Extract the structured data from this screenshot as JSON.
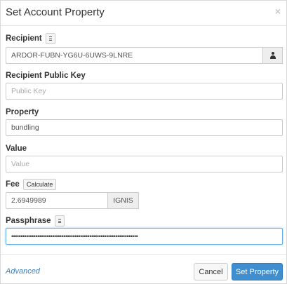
{
  "dialog": {
    "title": "Set Account Property",
    "close_symbol": "×"
  },
  "recipient": {
    "label": "Recipient",
    "value": "ARDOR-FUBN-YG6U-6UWS-9LNRE",
    "addon_icon": "user-icon"
  },
  "recipient_public_key": {
    "label": "Recipient Public Key",
    "placeholder": "Public Key"
  },
  "property": {
    "label": "Property",
    "value": "bundling"
  },
  "value_field": {
    "label": "Value",
    "placeholder": "Value"
  },
  "fee": {
    "label": "Fee",
    "calculate_label": "Calculate",
    "value": "2.6949989",
    "unit": "IGNIS"
  },
  "passphrase": {
    "label": "Passphrase",
    "value": "••••••••••••••••••••••••••••••••••••••••••••••••••••••••••••••••••••"
  },
  "footer": {
    "advanced_label": "Advanced",
    "cancel_label": "Cancel",
    "submit_label": "Set Property"
  },
  "colors": {
    "primary": "#3e8ed0",
    "link": "#3a7ebf"
  }
}
